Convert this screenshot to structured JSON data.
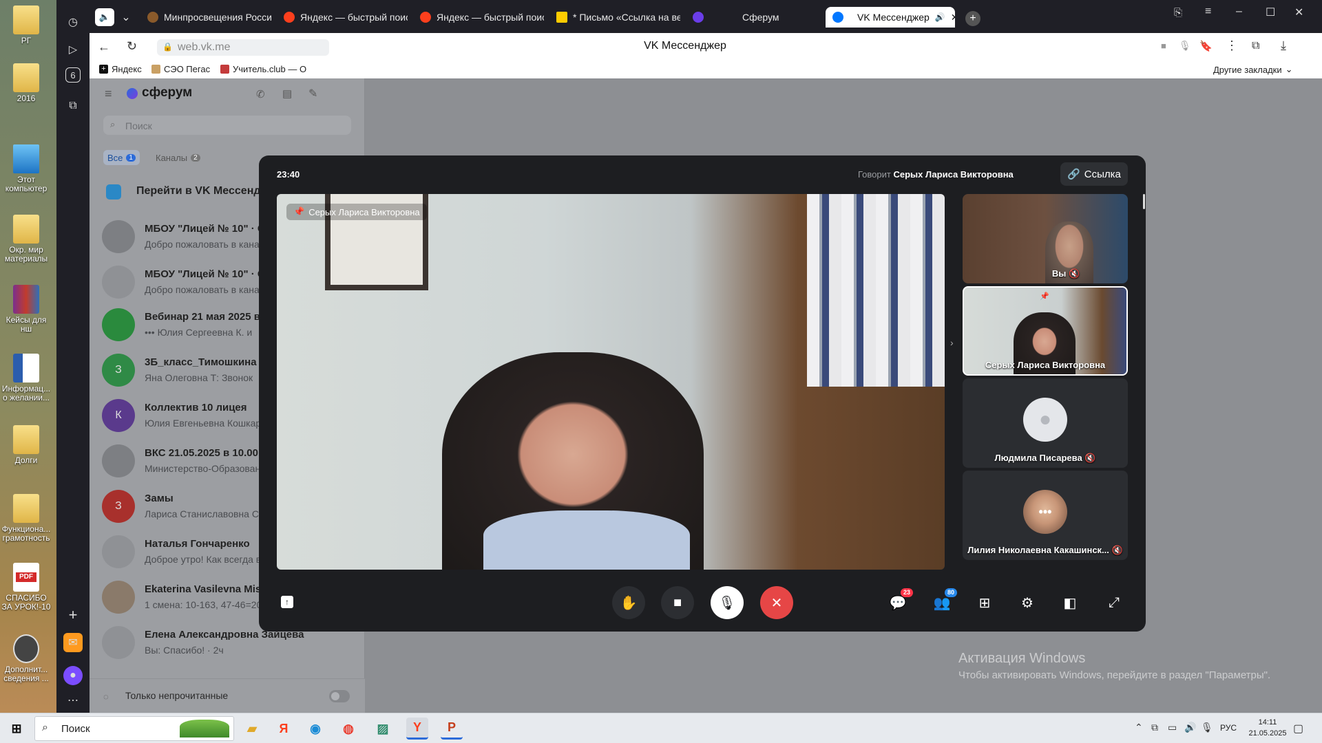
{
  "desktop": {
    "icons": [
      {
        "label": "РГ"
      },
      {
        "label": "2016"
      },
      {
        "label": "Этот компьютер"
      },
      {
        "label": "Окр. мир материалы"
      },
      {
        "label": "Кейсы для нш"
      },
      {
        "label": "Информац... о желании..."
      },
      {
        "label": "Долги"
      },
      {
        "label": "Функциона... грамотность"
      },
      {
        "label": "СПАСИБО ЗА УРОК!-10"
      },
      {
        "label": "Дополнит... сведения ..."
      }
    ],
    "watermark": {
      "title": "Активация Windows",
      "subtitle": "Чтобы активировать Windows, перейдите в раздел \"Параметры\"."
    }
  },
  "browser": {
    "tabs": [
      {
        "label": "Минпросвещения Росси",
        "color": "#8a5a2b"
      },
      {
        "label": "Яндекс — быстрый поиск",
        "color": "#fc3f1d"
      },
      {
        "label": "Яндекс — быстрый поиск",
        "color": "#fc3f1d"
      },
      {
        "label": "* Письмо «Ссылка на веб",
        "color": "#ffcc00"
      },
      {
        "label": "Сферум",
        "color": "#6a3de8"
      },
      {
        "label": "VK Мессенджер",
        "color": "#0077ff",
        "active": true
      }
    ],
    "address": "web.vk.me",
    "page_title": "VK Мессенджер",
    "bookmarks": [
      "Яндекс",
      "СЭО Пегас",
      "Учитель.club — О"
    ],
    "bookmarks_other": "Другие закладки"
  },
  "messenger": {
    "brand": "сферум",
    "search_placeholder": "Поиск",
    "filters": [
      {
        "label": "Все",
        "count": "1"
      },
      {
        "label": "Каналы",
        "count": "2"
      }
    ],
    "goto_vk": "Перейти в VK Мессендж",
    "chats": [
      {
        "name": "МБОУ \"Лицей № 10\" · С",
        "preview": "Добро пожаловать в канал",
        "color": "#7d7f83",
        "initial": ""
      },
      {
        "name": "МБОУ \"Лицей № 10\" · С",
        "preview": "Добро пожаловать в канал",
        "color": "#8f9195",
        "initial": ""
      },
      {
        "name": "Вебинар 21 мая 2025 в 1",
        "preview": "••• Юлия Сергеевна К. и",
        "color": "#2a8a3d",
        "initial": ""
      },
      {
        "name": "3Б_класс_Тимошкина",
        "preview": "Яна Олеговна Т: Звонок",
        "color": "#2f8a46",
        "initial": "З"
      },
      {
        "name": "Коллектив 10 лицея",
        "preview": "Юлия Евгеньевна Кошкар",
        "color": "#5a3a8c",
        "initial": "К"
      },
      {
        "name": "ВКС 21.05.2025 в 10.00",
        "preview": "Министерство-Образован",
        "color": "#7d7f83",
        "initial": ""
      },
      {
        "name": "Замы",
        "preview": "Лариса Станиславовна С:",
        "color": "#a8302c",
        "initial": "З"
      },
      {
        "name": "Наталья Гончаренко",
        "preview": "Доброе утро! Как всегда в",
        "color": "#8f9195",
        "initial": ""
      },
      {
        "name": "Ekaterina Vasilevna Mish",
        "preview": "1 смена: 10-163, 47-46=20",
        "color": "#8a7a6a",
        "initial": ""
      },
      {
        "name": "Елена Александровна Зайцева",
        "preview": "Вы: Спасибо! · 2ч",
        "color": "#8f9195",
        "initial": ""
      }
    ],
    "unread_only": "Только непрочитанные"
  },
  "call": {
    "timer": "23:40",
    "speaking_prefix": "Говорит",
    "speaker": "Серых Лариса Викторовна",
    "link_button": "Ссылка",
    "main_label": "Серых Лариса Викторовна",
    "participants": [
      {
        "name": "Вы",
        "muted": true
      },
      {
        "name": "Серых Лариса Викторовна",
        "muted": false
      },
      {
        "name": "Людмила Писарева",
        "muted": true
      },
      {
        "name": "Лилия Николаевна Какашинск...",
        "muted": true
      }
    ],
    "chat_badge": "23",
    "people_badge": "80"
  },
  "taskbar": {
    "search_label": "Поиск",
    "lang": "РУС",
    "time": "14:11",
    "date": "21.05.2025"
  }
}
